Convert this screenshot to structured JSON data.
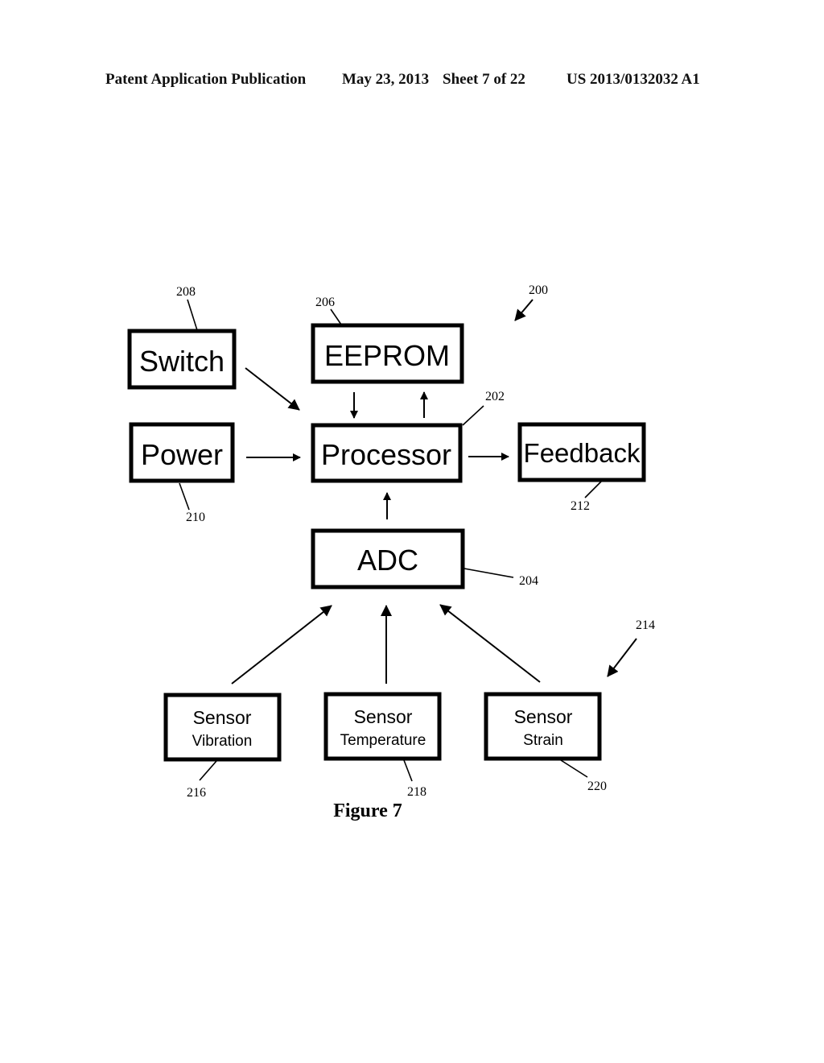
{
  "header": {
    "publication": "Patent Application Publication",
    "date": "May 23, 2013",
    "sheet": "Sheet 7 of 22",
    "number": "US 2013/0132032 A1"
  },
  "figure": {
    "caption": "Figure 7",
    "system_ref": "200",
    "sensor_group_ref": "214",
    "blocks": {
      "switch": {
        "label": "Switch",
        "ref": "208"
      },
      "eeprom": {
        "label": "EEPROM",
        "ref": "206"
      },
      "power": {
        "label": "Power",
        "ref": "210"
      },
      "processor": {
        "label": "Processor",
        "ref": "202"
      },
      "feedback": {
        "label": "Feedback",
        "ref": "212"
      },
      "adc": {
        "label": "ADC",
        "ref": "204"
      },
      "sensor_vibration": {
        "label": "Sensor",
        "sublabel": "Vibration",
        "ref": "216"
      },
      "sensor_temperature": {
        "label": "Sensor",
        "sublabel": "Temperature",
        "ref": "218"
      },
      "sensor_strain": {
        "label": "Sensor",
        "sublabel": "Strain",
        "ref": "220"
      }
    },
    "connections": [
      {
        "from": "switch",
        "to": "processor"
      },
      {
        "from": "power",
        "to": "processor"
      },
      {
        "from": "eeprom",
        "to": "processor"
      },
      {
        "from": "processor",
        "to": "eeprom"
      },
      {
        "from": "processor",
        "to": "feedback"
      },
      {
        "from": "adc",
        "to": "processor"
      },
      {
        "from": "sensor_vibration",
        "to": "adc"
      },
      {
        "from": "sensor_temperature",
        "to": "adc"
      },
      {
        "from": "sensor_strain",
        "to": "adc"
      }
    ]
  }
}
